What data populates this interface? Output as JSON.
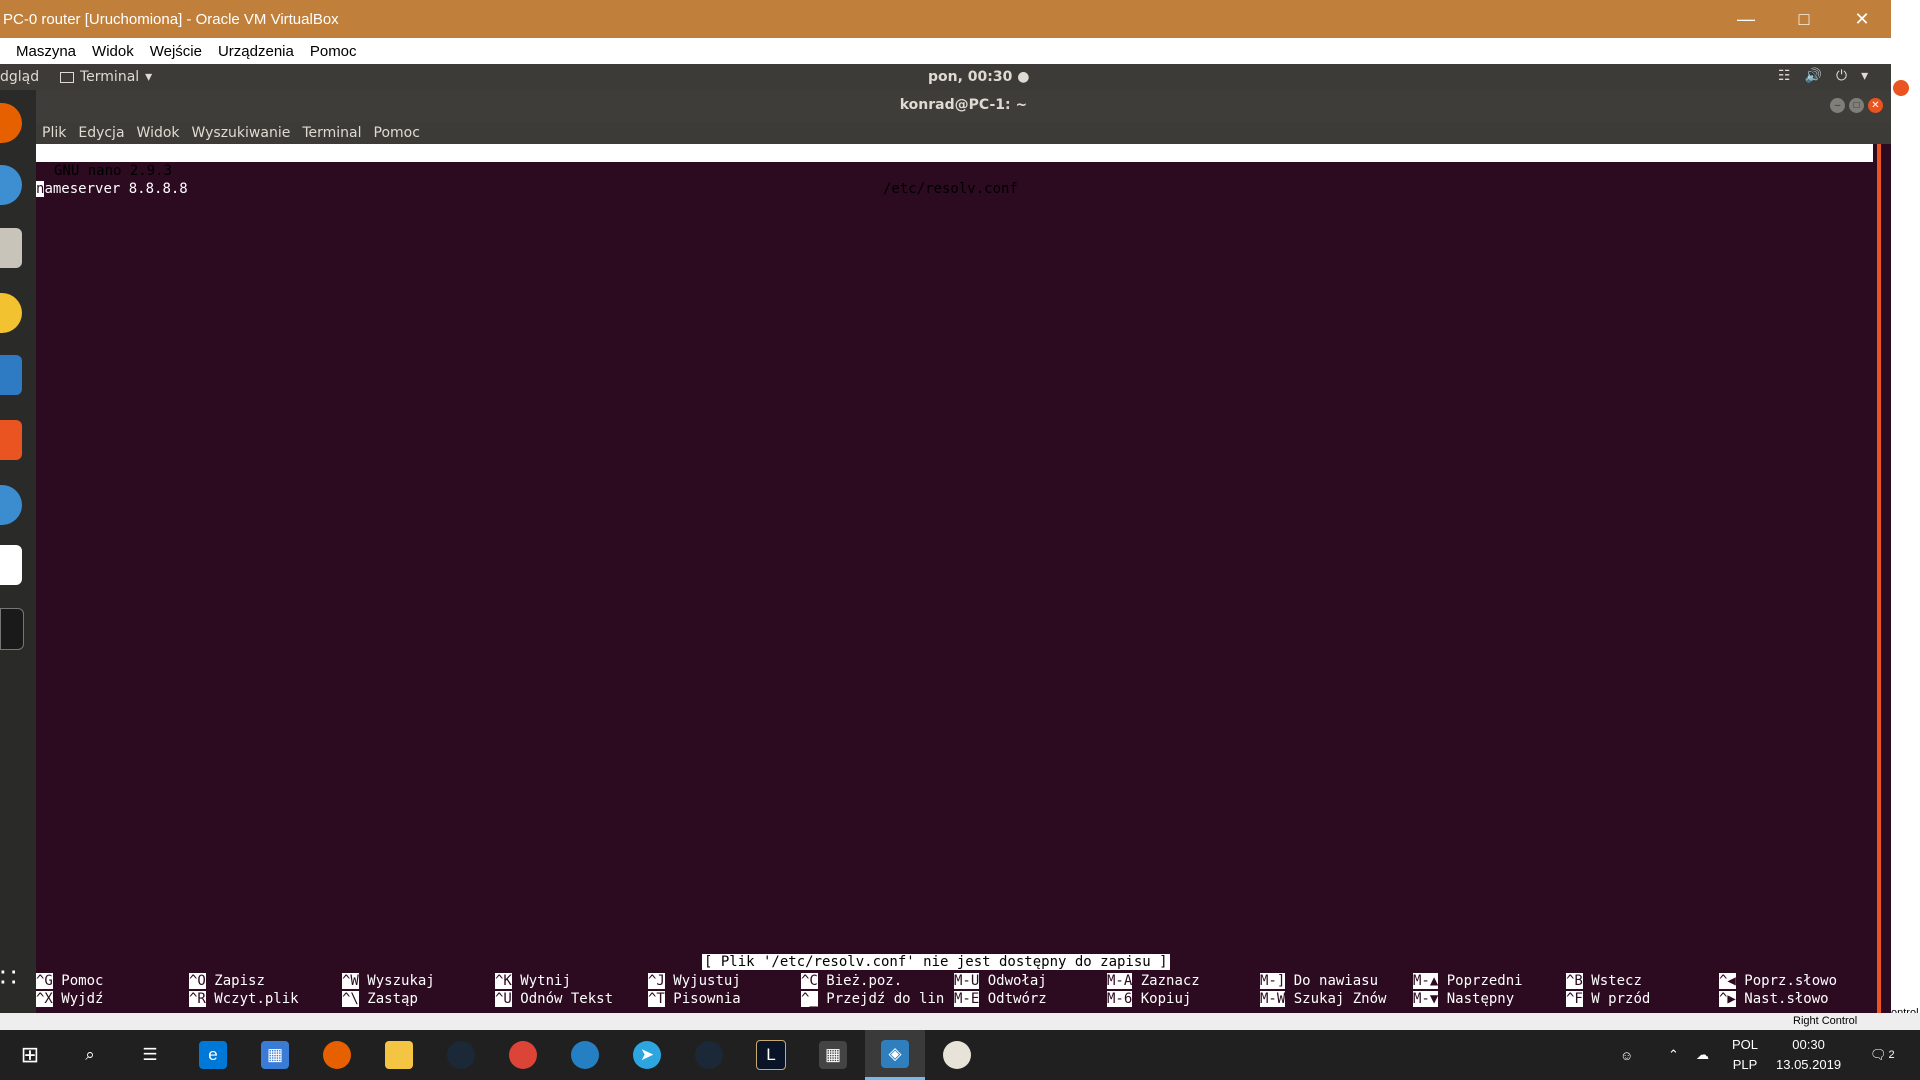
{
  "vbox": {
    "title": "PC-0 router [Uruchomiona] - Oracle VM VirtualBox",
    "menu": [
      "Maszyna",
      "Widok",
      "Wejście",
      "Urządzenia",
      "Pomoc"
    ],
    "host_key": "Right Control",
    "right_edge_text": "ontrol"
  },
  "ubuntu_panel": {
    "activities": "dgląd",
    "app_menu": "Terminal",
    "clock": "pon, 00:30"
  },
  "terminal": {
    "title": "konrad@PC-1: ~",
    "menu": [
      "Plik",
      "Edycja",
      "Widok",
      "Wyszukiwanie",
      "Terminal",
      "Pomoc"
    ]
  },
  "nano": {
    "version": "GNU nano 2.9.3",
    "filename": "/etc/resolv.conf",
    "line1_first": "n",
    "line1_rest": "ameserver 8.8.8.8",
    "status": "[ Plik '/etc/resolv.conf' nie jest dostępny do zapisu ]",
    "shortcuts_row1": [
      {
        "key": "^G",
        "label": "Pomoc"
      },
      {
        "key": "^O",
        "label": "Zapisz"
      },
      {
        "key": "^W",
        "label": "Wyszukaj"
      },
      {
        "key": "^K",
        "label": "Wytnij"
      },
      {
        "key": "^J",
        "label": "Wyjustuj"
      },
      {
        "key": "^C",
        "label": "Bież.poz."
      },
      {
        "key": "M-U",
        "label": "Odwołaj"
      },
      {
        "key": "M-A",
        "label": "Zaznacz"
      },
      {
        "key": "M-]",
        "label": "Do nawiasu"
      },
      {
        "key": "M-▲",
        "label": "Poprzedni"
      },
      {
        "key": "^B",
        "label": "Wstecz"
      },
      {
        "key": "^◀",
        "label": "Poprz.słowo"
      }
    ],
    "shortcuts_row2": [
      {
        "key": "^X",
        "label": "Wyjdź"
      },
      {
        "key": "^R",
        "label": "Wczyt.plik"
      },
      {
        "key": "^\\",
        "label": "Zastąp"
      },
      {
        "key": "^U",
        "label": "Odnów Tekst"
      },
      {
        "key": "^T",
        "label": "Pisownia"
      },
      {
        "key": "^_",
        "label": "Przejdź do lin"
      },
      {
        "key": "M-E",
        "label": "Odtwórz"
      },
      {
        "key": "M-6",
        "label": "Kopiuj"
      },
      {
        "key": "M-W",
        "label": "Szukaj Znów"
      },
      {
        "key": "M-▼",
        "label": "Następny"
      },
      {
        "key": "^F",
        "label": "W przód"
      },
      {
        "key": "^▶",
        "label": "Nast.słowo"
      }
    ]
  },
  "taskbar": {
    "language": "POL",
    "layout": "PLP",
    "time": "00:30",
    "date": "13.05.2019",
    "notifications": "2",
    "apps": [
      "start-icon",
      "search-icon",
      "task-view-icon",
      "edge-icon",
      "store-icon",
      "firefox-icon",
      "file-explorer-icon",
      "steam-icon",
      "chrome-icon",
      "teamspeak-icon",
      "telegram-icon",
      "steam-icon-2",
      "league-icon",
      "calculator-icon",
      "virtualbox-icon",
      "paint-icon"
    ]
  },
  "colors": {
    "vbox_title": "#c0803c",
    "terminal_bg": "#2c0a20",
    "ubuntu_orange": "#e95420",
    "taskbar": "#202020"
  }
}
